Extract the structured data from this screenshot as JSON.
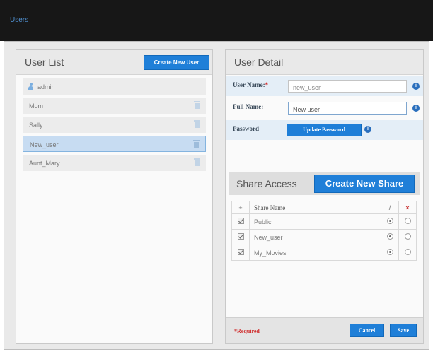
{
  "app": {
    "title": "Users"
  },
  "user_list": {
    "title": "User List",
    "create_button": "Create New User",
    "users": [
      {
        "name": "admin",
        "is_admin": true,
        "selected": false
      },
      {
        "name": "Mom",
        "is_admin": false,
        "selected": false
      },
      {
        "name": "Sally",
        "is_admin": false,
        "selected": false
      },
      {
        "name": "New_user",
        "is_admin": false,
        "selected": true
      },
      {
        "name": "Aunt_Mary",
        "is_admin": false,
        "selected": false
      }
    ]
  },
  "user_detail": {
    "title": "User Detail",
    "user_name": {
      "label": "User Name:",
      "required_mark": "*",
      "value": "new_user"
    },
    "full_name": {
      "label": "Full Name:",
      "value": "New user"
    },
    "password": {
      "label": "Password",
      "button": "Update Password"
    },
    "info_glyph": "i"
  },
  "share_access": {
    "title": "Share Access",
    "create_button": "Create New Share",
    "columns": {
      "add": "+",
      "name": "Share Name",
      "edit": "/",
      "deny": "×"
    },
    "shares": [
      {
        "name": "Public",
        "checked": true,
        "access": "full"
      },
      {
        "name": "New_user",
        "checked": true,
        "access": "full"
      },
      {
        "name": "My_Movies",
        "checked": true,
        "access": "full"
      }
    ]
  },
  "footer": {
    "required_note": "*Required",
    "cancel": "Cancel",
    "save": "Save"
  },
  "colors": {
    "topbar": "#171717",
    "title_text": "#4f8fcf",
    "accent_button": "#1f7fd8",
    "selected_row": "#c7dcf2",
    "required": "#d02020"
  }
}
